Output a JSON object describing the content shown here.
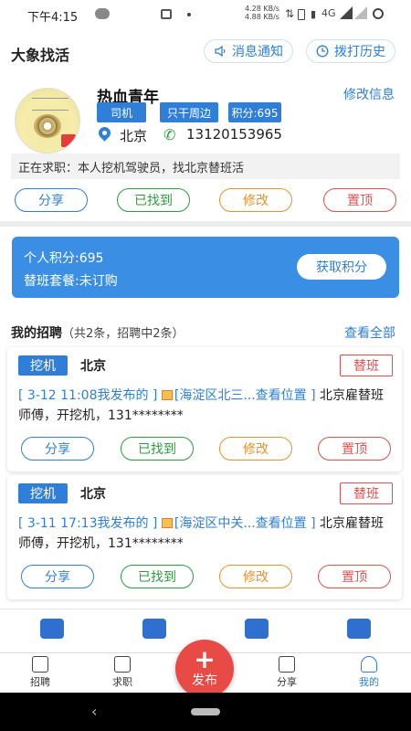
{
  "status_bar": {
    "time": "下午4:15",
    "net_up": "4.28 KB/s",
    "net_down": "4.88 KB/s",
    "network": "4G"
  },
  "header": {
    "title": "大象找活",
    "notify_label": "消息通知",
    "call_history_label": "拨打历史"
  },
  "profile": {
    "name": "热血青年",
    "edit_label": "修改信息",
    "tags": [
      "司机",
      "只干周边",
      "积分:695"
    ],
    "location": "北京",
    "phone": "13120153965",
    "seeking": "正在求职：本人挖机驾驶员，找北京替班活",
    "actions": [
      "分享",
      "已找到",
      "修改",
      "置顶"
    ]
  },
  "points": {
    "personal": "个人积分:695",
    "package": "替班套餐:未订购",
    "get_label": "获取积分"
  },
  "recruitment": {
    "title": "我的招聘",
    "summary": "（共2条，招聘中2条）",
    "view_all": "查看全部",
    "items": [
      {
        "category": "挖机",
        "city": "北京",
        "type": "替班",
        "posted": "[ 3-12 11:08我发布的 ]",
        "location_link": "[海淀区北三...查看位置 ]",
        "text": "北京雇替班师傅，开挖机，131********",
        "actions": [
          "分享",
          "已找到",
          "修改",
          "置顶"
        ]
      },
      {
        "category": "挖机",
        "city": "北京",
        "type": "替班",
        "posted": "[ 3-11 17:13我发布的 ]",
        "location_link": "[海淀区中关...查看位置 ]",
        "text": "北京雇替班师傅，开挖机，131********",
        "actions": [
          "分享",
          "已找到",
          "修改",
          "置顶"
        ]
      }
    ]
  },
  "bottom_nav": {
    "items": [
      "招聘",
      "求职",
      "分享",
      "我的"
    ],
    "publish_label": "发布",
    "active": "我的"
  },
  "colors": {
    "accent": "#2f7fd8",
    "green": "#2a9d3e",
    "orange": "#e8922c",
    "red": "#e05050",
    "publish": "#e84a46"
  }
}
